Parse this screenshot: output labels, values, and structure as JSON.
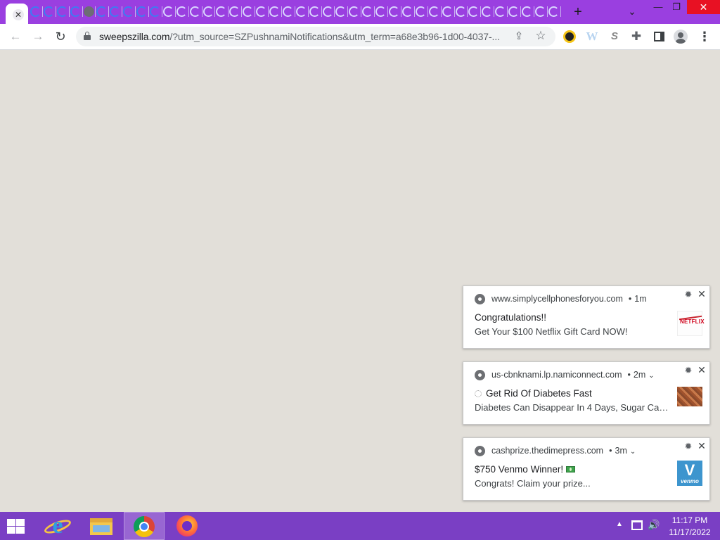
{
  "browser": {
    "tab_close_glyph": "✕",
    "new_tab_glyph": "+",
    "tab_search_glyph": "⌄",
    "window": {
      "minimize": "—",
      "maximize": "❐",
      "close": "✕"
    },
    "mini_tab_count": 40,
    "toolbar": {
      "back_glyph": "←",
      "forward_glyph": "→",
      "reload_glyph": "↻",
      "url_host": "sweepszilla.com",
      "url_rest": "/?utm_source=SZPushnamiNotifications&utm_term=a68e3b96-1d00-4037-...",
      "share_glyph": "⇪",
      "bookmark_glyph": "☆",
      "extensions": [
        {
          "name": "extension-icon-1",
          "glyph": ""
        },
        {
          "name": "extension-icon-2",
          "glyph": "W"
        },
        {
          "name": "extension-icon-3",
          "glyph": "S"
        },
        {
          "name": "puzzle-icon",
          "glyph": "✚"
        },
        {
          "name": "side-panel-icon",
          "glyph": ""
        },
        {
          "name": "profile-icon",
          "glyph": ""
        },
        {
          "name": "menu-icon",
          "glyph": "⋮"
        }
      ]
    }
  },
  "notifications": [
    {
      "origin": "www.simplycellphonesforyou.com",
      "time": "1m",
      "has_chevron": false,
      "title": "Congratulations!!",
      "body": "Get Your $100 Netflix Gift Card NOW!",
      "thumbnail": "netflix-thumbnail",
      "thumbnail_text": "NETFLIX"
    },
    {
      "origin": "us-cbnknami.lp.namiconnect.com",
      "time": "2m",
      "has_chevron": true,
      "title": "Get Rid Of Diabetes Fast",
      "body": "Diabetes Can Disappear In 4 Days, Sugar Can ...",
      "thumbnail": "food-thumbnail",
      "thumbnail_text": ""
    },
    {
      "origin": "cashprize.thedimepress.com",
      "time": "3m",
      "has_chevron": true,
      "title": "$750 Venmo Winner!",
      "body": "Congrats! Claim your prize...",
      "thumbnail": "venmo-thumbnail",
      "thumbnail_text": "venmo"
    }
  ],
  "notification_controls": {
    "dot": "•",
    "chevron": "⌄",
    "settings_glyph": "✹",
    "close_glyph": "✕"
  },
  "taskbar": {
    "apps": [
      "internet-explorer",
      "file-explorer",
      "chrome",
      "firefox"
    ],
    "tray_up_glyph": "▲",
    "volume_glyph": "🔊",
    "time": "11:17 PM",
    "date": "11/17/2022"
  },
  "colors": {
    "tabstrip": "#9a3fe0",
    "page_background": "#e2dfd9",
    "taskbar": "#7a3fc4",
    "close_red": "#e81123"
  }
}
